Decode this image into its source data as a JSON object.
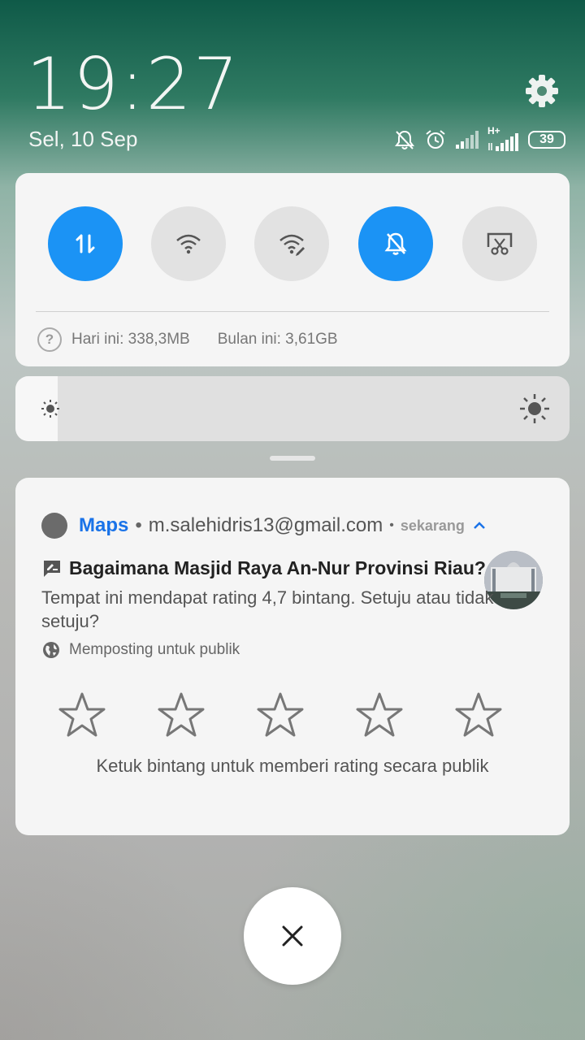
{
  "lockscreen": {
    "time": "19:27",
    "date": "Sel, 10 Sep"
  },
  "status_bar": {
    "network_label": "H+",
    "battery_level": "39",
    "icons": [
      "notifications-muted-icon",
      "alarm-icon",
      "signal-icon",
      "mobile-data-signal-icon",
      "battery-icon"
    ]
  },
  "quick_settings": {
    "toggles": [
      {
        "name": "mobile-data",
        "icon": "data-transfer-icon",
        "on": true
      },
      {
        "name": "wifi",
        "icon": "wifi-icon",
        "on": false
      },
      {
        "name": "wifi-hotspot",
        "icon": "wifi-edit-icon",
        "on": false
      },
      {
        "name": "silent-mode",
        "icon": "bell-off-icon",
        "on": true
      },
      {
        "name": "screenshot",
        "icon": "screenshot-icon",
        "on": false
      }
    ],
    "usage_today": "Hari ini: 338,3MB",
    "usage_month": "Bulan ini: 3,61GB"
  },
  "brightness": {
    "level_fraction": 0.02
  },
  "notification": {
    "app_name": "Maps",
    "account": "m.salehidris13@gmail.com",
    "time": "sekarang",
    "title": "Bagaimana Masjid Raya An-Nur Provinsi Riau?",
    "body": "Tempat ini mendapat rating 4,7 bintang. Setuju atau tidak setuju?",
    "posting_label": "Memposting untuk publik",
    "star_count": 5,
    "rating_hint": "Ketuk bintang untuk memberi rating secara publik"
  },
  "colors": {
    "accent": "#1b93f5",
    "app_name": "#1a73e8",
    "panel_bg": "#f5f5f5"
  }
}
